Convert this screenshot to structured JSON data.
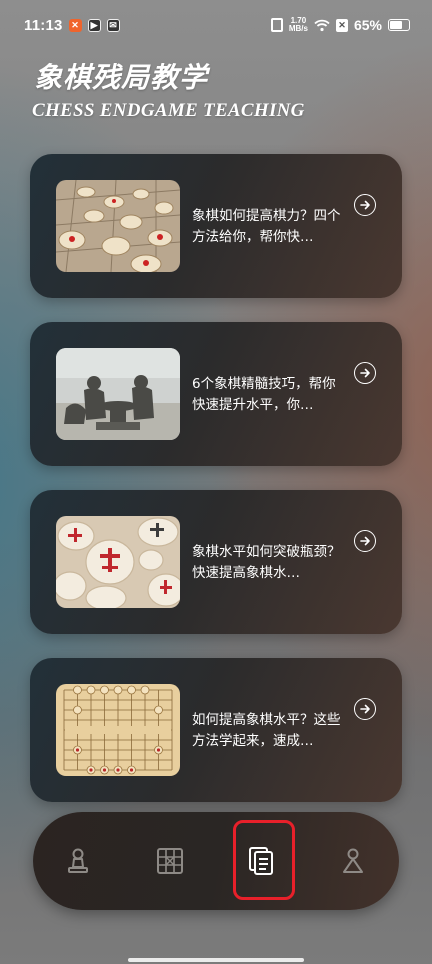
{
  "status_bar": {
    "time": "11:13",
    "net_speed_value": "1.70",
    "net_speed_unit": "MB/s",
    "battery_percent": "65%",
    "battery_level": 0.65
  },
  "header": {
    "title_cn": "象棋残局教学",
    "title_en": "CHESS ENDGAME TEACHING"
  },
  "articles": [
    {
      "text": "象棋如何提高棋力？四个方法给你，帮你快…",
      "icon": "arrow-right-circle-icon"
    },
    {
      "text": "6个象棋精髓技巧，帮你快速提升水平，你…",
      "icon": "arrow-right-circle-icon"
    },
    {
      "text": "象棋水平如何突破瓶颈？快速提高象棋水…",
      "icon": "arrow-right-circle-icon"
    },
    {
      "text": "如何提高象棋水平？这些方法学起来，速成…",
      "icon": "arrow-right-circle-icon"
    }
  ],
  "bottom_nav": {
    "items": [
      {
        "icon": "chess-pawn-icon"
      },
      {
        "icon": "chessboard-icon"
      },
      {
        "icon": "document-icon",
        "selected": true
      },
      {
        "icon": "person-icon"
      }
    ],
    "highlight_color": "#e8202a"
  }
}
